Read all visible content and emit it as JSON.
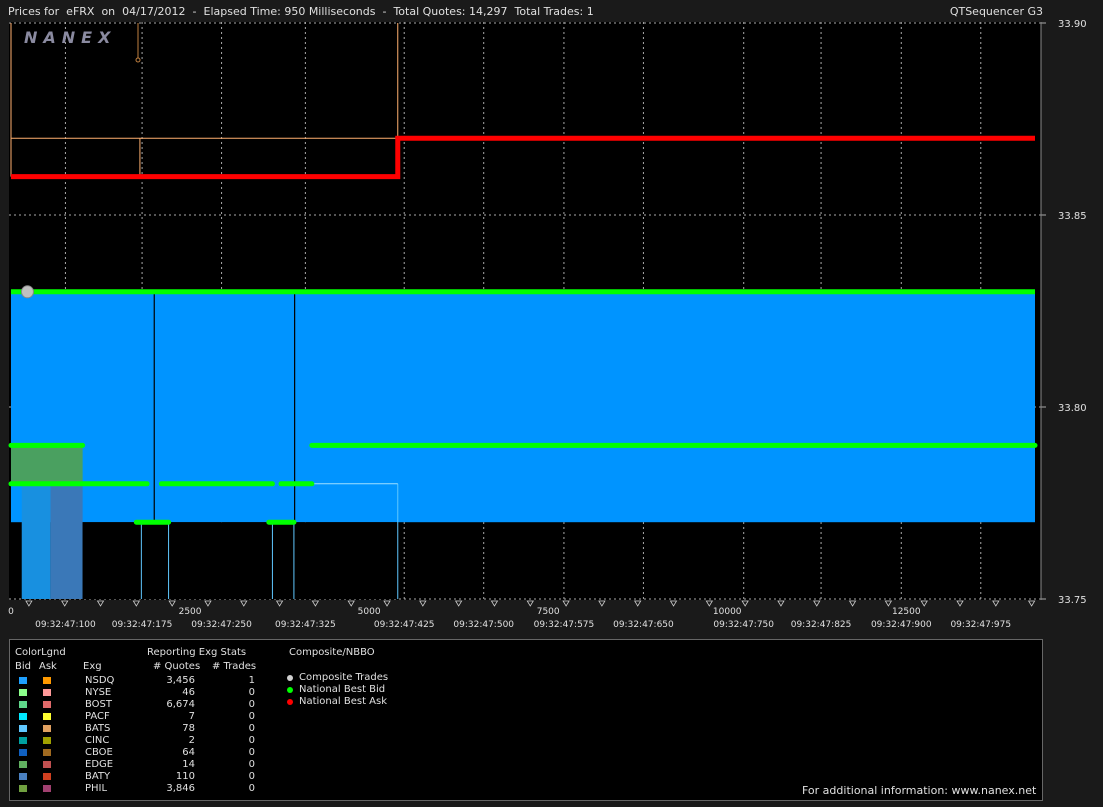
{
  "header": {
    "title": "Prices for  eFRX  on  04/17/2012  -  Elapsed Time: 950 Milliseconds  -  Total Quotes: 14,297  Total Trades: 1",
    "app_name": "QTSequencer G3",
    "watermark": "NANEX"
  },
  "chart_data": {
    "type": "line",
    "ylim": [
      33.75,
      33.9
    ],
    "yticks": [
      "33.90",
      "33.85",
      "33.80",
      "33.75"
    ],
    "xlim": [
      0,
      14297
    ],
    "xticks": [
      "0",
      "2500",
      "5000",
      "7500",
      "10000",
      "12500"
    ],
    "xtick_values": [
      0,
      2500,
      5000,
      7500,
      10000,
      12500
    ],
    "time_labels": [
      "09:32:47:100",
      "09:32:47:175",
      "09:32:47:250",
      "09:32:47:325",
      "09:32:47:425",
      "09:32:47:500",
      "09:32:47:575",
      "09:32:47:650",
      "09:32:47:750",
      "09:32:47:825",
      "09:32:47:900",
      "09:32:47:975"
    ],
    "time_label_positions": [
      760,
      1830,
      2940,
      4110,
      5490,
      6600,
      7720,
      8830,
      10230,
      11310,
      12430,
      13540
    ],
    "grid": true,
    "series": [
      {
        "name": "National Best Ask",
        "color": "#ff0000",
        "points": [
          [
            0,
            33.86
          ],
          [
            5400,
            33.86
          ],
          [
            5400,
            33.87
          ],
          [
            14297,
            33.87
          ]
        ]
      },
      {
        "name": "National Best Bid",
        "color": "#00ff00",
        "points": [
          [
            0,
            33.83
          ],
          [
            14297,
            33.83
          ]
        ]
      },
      {
        "name": "Composite Trades",
        "color": "#c0c0c0",
        "points": [
          [
            230,
            33.83
          ]
        ]
      }
    ],
    "bid_band": {
      "color": "#0094ff",
      "from": 33.77,
      "to": 33.83,
      "x_start": 0,
      "x_end": 14297
    },
    "exchange_bid_segments": [
      {
        "color": "#00ff00",
        "y": 33.79,
        "x_start": 0,
        "x_end": 1000
      },
      {
        "color": "#00ff00",
        "y": 33.79,
        "x_start": 4200,
        "x_end": 14297
      },
      {
        "color": "#00ff00",
        "y": 33.78,
        "x_start": 0,
        "x_end": 1900
      },
      {
        "color": "#00ff00",
        "y": 33.78,
        "x_start": 2100,
        "x_end": 3650
      },
      {
        "color": "#00ff00",
        "y": 33.78,
        "x_start": 3770,
        "x_end": 4200
      },
      {
        "color": "#00ff00",
        "y": 33.77,
        "x_start": 1750,
        "x_end": 2200
      },
      {
        "color": "#00ff00",
        "y": 33.77,
        "x_start": 3600,
        "x_end": 3950
      }
    ],
    "ask_trace": {
      "color": "#ffb070",
      "points": [
        [
          0,
          33.87
        ],
        [
          5400,
          33.87
        ],
        [
          5400,
          33.9
        ]
      ],
      "marker_x": 1800,
      "marker_y_from": 33.86,
      "marker_y_to": 33.87
    }
  },
  "legend": {
    "color_header": "ColorLgnd",
    "bid_header": "Bid",
    "ask_header": "Ask",
    "exg_header": "Exg",
    "stats_header": "Reporting Exg Stats",
    "quotes_header": "# Quotes",
    "trades_header": "# Trades",
    "composite_header": "Composite/NBBO",
    "rows": [
      {
        "exg": "NSDQ",
        "quotes": "3,456",
        "trades": "1",
        "bid_color": "#1ea0ff",
        "ask_color": "#ff9a00"
      },
      {
        "exg": "NYSE",
        "quotes": "46",
        "trades": "0",
        "bid_color": "#8cff8c",
        "ask_color": "#ff9a9a"
      },
      {
        "exg": "BOST",
        "quotes": "6,674",
        "trades": "0",
        "bid_color": "#5fd78a",
        "ask_color": "#e06a6a"
      },
      {
        "exg": "PACF",
        "quotes": "7",
        "trades": "0",
        "bid_color": "#00e8ff",
        "ask_color": "#ffff30"
      },
      {
        "exg": "BATS",
        "quotes": "78",
        "trades": "0",
        "bid_color": "#60c8ff",
        "ask_color": "#e0a060"
      },
      {
        "exg": "CINC",
        "quotes": "2",
        "trades": "0",
        "bid_color": "#00a0a0",
        "ask_color": "#a0a000"
      },
      {
        "exg": "CBOE",
        "quotes": "64",
        "trades": "0",
        "bid_color": "#1060c0",
        "ask_color": "#a06a20"
      },
      {
        "exg": "EDGE",
        "quotes": "14",
        "trades": "0",
        "bid_color": "#60b060",
        "ask_color": "#c05050"
      },
      {
        "exg": "BATY",
        "quotes": "110",
        "trades": "0",
        "bid_color": "#4a80c0",
        "ask_color": "#d04020"
      },
      {
        "exg": "PHIL",
        "quotes": "3,846",
        "trades": "0",
        "bid_color": "#70a040",
        "ask_color": "#a04070"
      }
    ],
    "composite_items": [
      {
        "label": "Composite Trades",
        "color": "#d0d0d0"
      },
      {
        "label": "National Best Bid",
        "color": "#00ff00"
      },
      {
        "label": "National Best Ask",
        "color": "#ff0000"
      }
    ],
    "footer": "For additional information: www.nanex.net"
  }
}
